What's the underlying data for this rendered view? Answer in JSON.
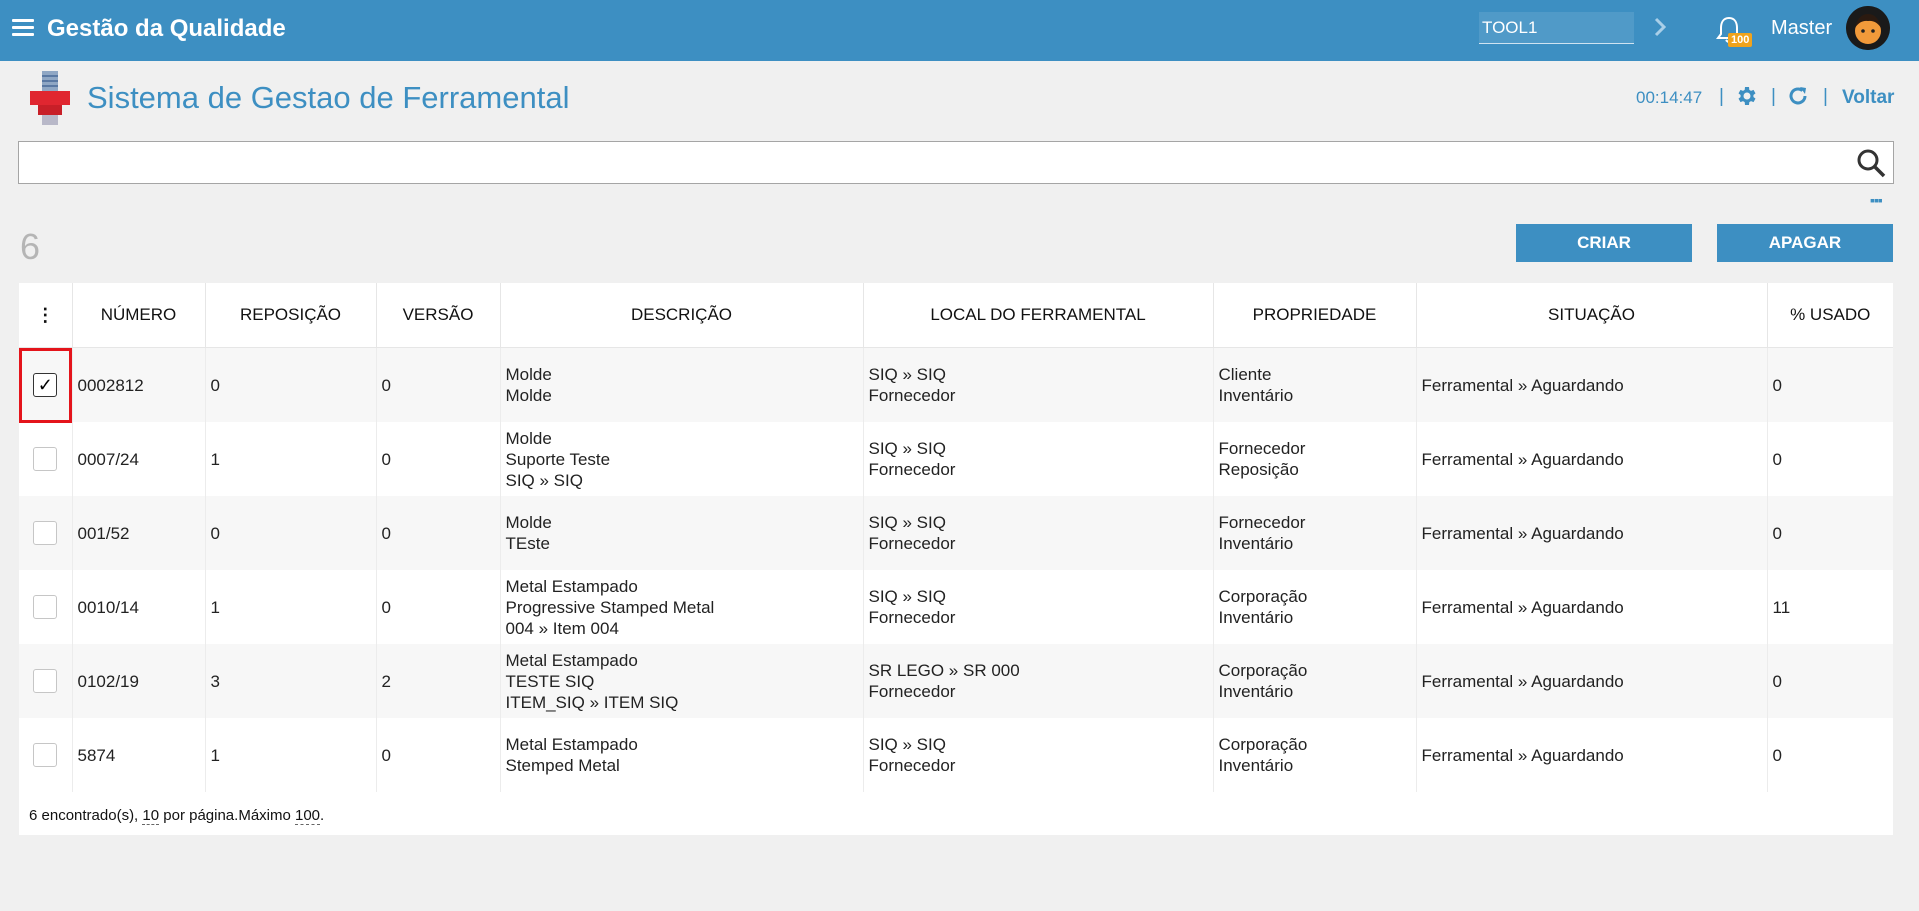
{
  "header": {
    "app_title": "Gestão da Qualidade",
    "tool_value": "TOOL1",
    "notification_count": "100",
    "user_name": "Master"
  },
  "page": {
    "title": "Sistema de Gestao de Ferramental",
    "timer": "00:14:47",
    "back_label": "Voltar",
    "separator": "|"
  },
  "search": {
    "value": "",
    "placeholder": ""
  },
  "toolbar": {
    "count": "6",
    "create_label": "CRIAR",
    "delete_label": "APAGAR"
  },
  "table": {
    "columns": [
      "NÚMERO",
      "REPOSIÇÃO",
      "VERSÃO",
      "DESCRIÇÃO",
      "LOCAL DO FERRAMENTAL",
      "PROPRIEDADE",
      "SITUAÇÃO",
      "% USADO"
    ],
    "rows": [
      {
        "checked": true,
        "numero": "0002812",
        "reposicao": "0",
        "versao": "0",
        "descricao": [
          "Molde",
          "Molde"
        ],
        "local": [
          "SIQ » SIQ",
          "Fornecedor"
        ],
        "propriedade": [
          "Cliente",
          "Inventário"
        ],
        "situacao": "Ferramental » Aguardando",
        "usado": "0"
      },
      {
        "checked": false,
        "numero": "0007/24",
        "reposicao": "1",
        "versao": "0",
        "descricao": [
          "Molde",
          "Suporte Teste",
          "SIQ » SIQ"
        ],
        "local": [
          "SIQ » SIQ",
          "Fornecedor"
        ],
        "propriedade": [
          "Fornecedor",
          "Reposição"
        ],
        "situacao": "Ferramental » Aguardando",
        "usado": "0"
      },
      {
        "checked": false,
        "numero": "001/52",
        "reposicao": "0",
        "versao": "0",
        "descricao": [
          "Molde",
          "TEste"
        ],
        "local": [
          "SIQ » SIQ",
          "Fornecedor"
        ],
        "propriedade": [
          "Fornecedor",
          "Inventário"
        ],
        "situacao": "Ferramental » Aguardando",
        "usado": "0"
      },
      {
        "checked": false,
        "numero": "0010/14",
        "reposicao": "1",
        "versao": "0",
        "descricao": [
          "Metal Estampado",
          "Progressive Stamped Metal",
          "004 » Item 004"
        ],
        "local": [
          "SIQ » SIQ",
          "Fornecedor"
        ],
        "propriedade": [
          "Corporação",
          "Inventário"
        ],
        "situacao": "Ferramental » Aguardando",
        "usado": "11"
      },
      {
        "checked": false,
        "numero": "0102/19",
        "reposicao": "3",
        "versao": "2",
        "descricao": [
          "Metal Estampado",
          "TESTE SIQ",
          "ITEM_SIQ » ITEM SIQ"
        ],
        "local": [
          "SR LEGO » SR 000",
          "Fornecedor"
        ],
        "propriedade": [
          "Corporação",
          "Inventário"
        ],
        "situacao": "Ferramental » Aguardando",
        "usado": "0"
      },
      {
        "checked": false,
        "numero": "5874",
        "reposicao": "1",
        "versao": "0",
        "descricao": [
          "Metal Estampado",
          "Stemped Metal"
        ],
        "local": [
          "SIQ » SIQ",
          "Fornecedor"
        ],
        "propriedade": [
          "Corporação",
          "Inventário"
        ],
        "situacao": "Ferramental » Aguardando",
        "usado": "0"
      }
    ],
    "footer": {
      "found_text": "6 encontrado(s), ",
      "per_page": "10",
      "per_page_text": " por página.Máximo ",
      "max": "100",
      "end": "."
    }
  },
  "colors": {
    "primary": "#3d8fc2",
    "highlight": "#e4141b",
    "badge": "#f0a31c"
  },
  "icons": [
    "menu-icon",
    "chevron-right-icon",
    "bell-icon",
    "avatar",
    "tool-logo-icon",
    "gear-icon",
    "refresh-icon",
    "search-icon",
    "more-icon",
    "column-menu-icon",
    "checkbox-icon"
  ]
}
